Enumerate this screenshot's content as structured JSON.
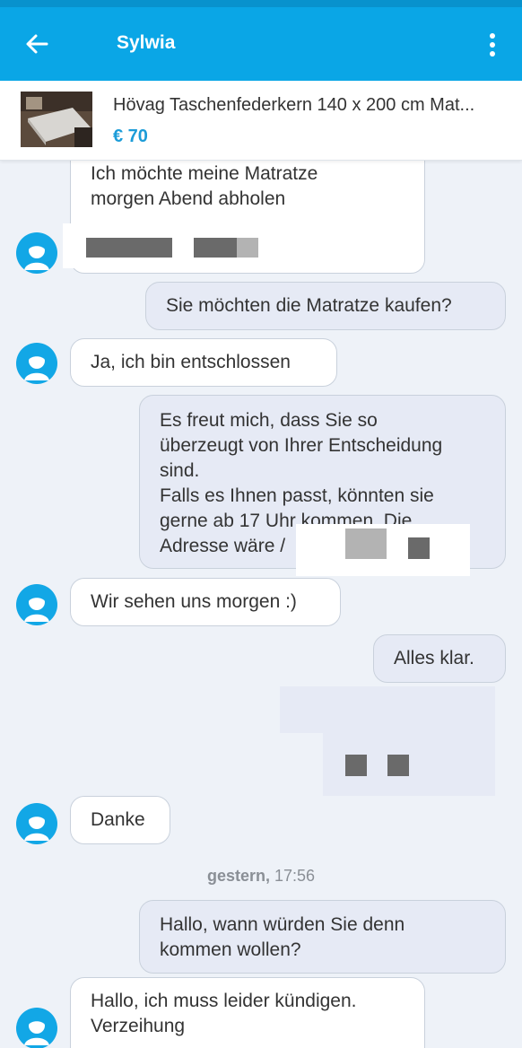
{
  "header": {
    "title": "Sylwia",
    "back_icon": "arrow-left-icon",
    "menu_icon": "more-vertical-icon",
    "color": "#0aa6e6"
  },
  "product": {
    "title": "Hövag Taschenfederkern 140 x 200 cm Mat...",
    "price": "€ 70",
    "price_color": "#1c9cd8"
  },
  "messages": [
    {
      "direction": "in",
      "text": "Ich möchte meine Matratze\nmorgen Abend abholen"
    },
    {
      "direction": "out",
      "text": "Sie möchten die Matratze kaufen?"
    },
    {
      "direction": "in",
      "text": "Ja, ich bin entschlossen"
    },
    {
      "direction": "out",
      "text": "Es freut mich, dass Sie so\nüberzeugt von Ihrer Entscheidung\nsind.\nFalls es Ihnen passt, könnten sie\ngerne ab 17 Uhr kommen. Die\nAdresse wäre /"
    },
    {
      "direction": "in",
      "text": "Wir sehen uns morgen :)"
    },
    {
      "direction": "out",
      "text": "Alles klar."
    },
    {
      "direction": "in",
      "text": "Danke"
    },
    {
      "direction": "out",
      "text": "Hallo, wann würden Sie denn\nkommen wollen?"
    },
    {
      "direction": "in",
      "text": "Hallo, ich muss leider kündigen.\nVerzeihung"
    }
  ],
  "date_separator": {
    "day": "gestern,",
    "time": "17:56"
  },
  "avatar_icon": "user-avatar-icon"
}
